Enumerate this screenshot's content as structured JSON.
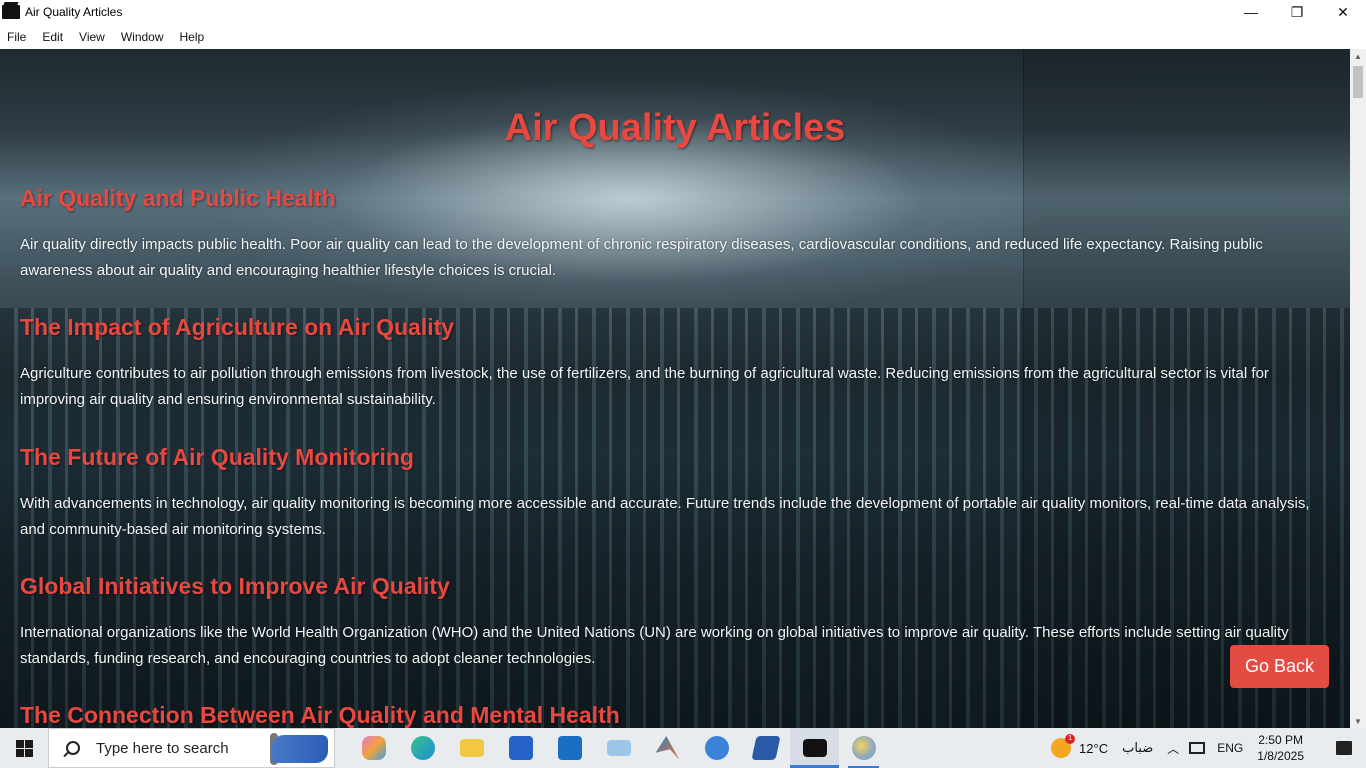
{
  "window": {
    "title": "Air Quality Articles",
    "controls": {
      "minimize": "—",
      "maximize": "❐",
      "close": "✕"
    }
  },
  "menu": [
    "File",
    "Edit",
    "View",
    "Window",
    "Help"
  ],
  "page": {
    "title": "Air Quality Articles",
    "articles": [
      {
        "heading": "Air Quality and Public Health",
        "body": "Air quality directly impacts public health. Poor air quality can lead to the development of chronic respiratory diseases, cardiovascular conditions, and reduced life expectancy. Raising public awareness about air quality and encouraging healthier lifestyle choices is crucial."
      },
      {
        "heading": "The Impact of Agriculture on Air Quality",
        "body": "Agriculture contributes to air pollution through emissions from livestock, the use of fertilizers, and the burning of agricultural waste. Reducing emissions from the agricultural sector is vital for improving air quality and ensuring environmental sustainability."
      },
      {
        "heading": "The Future of Air Quality Monitoring",
        "body": "With advancements in technology, air quality monitoring is becoming more accessible and accurate. Future trends include the development of portable air quality monitors, real-time data analysis, and community-based air monitoring systems."
      },
      {
        "heading": "Global Initiatives to Improve Air Quality",
        "body": "International organizations like the World Health Organization (WHO) and the United Nations (UN) are working on global initiatives to improve air quality. These efforts include setting air quality standards, funding research, and encouraging countries to adopt cleaner technologies."
      },
      {
        "heading": "The Connection Between Air Quality and Mental Health",
        "body": ""
      }
    ],
    "go_back_label": "Go Back"
  },
  "taskbar": {
    "search_placeholder": "Type here to search",
    "apps": [
      {
        "name": "copilot-icon",
        "color": "#c85ad8"
      },
      {
        "name": "edge-icon",
        "color": "#1f8fd6"
      },
      {
        "name": "file-explorer-icon",
        "color": "#f2c744"
      },
      {
        "name": "store-icon",
        "color": "#2563c9"
      },
      {
        "name": "outlook-icon",
        "color": "#1a6fc4"
      },
      {
        "name": "network-app-icon",
        "color": "#5aa0d8"
      },
      {
        "name": "matlab-icon",
        "color": "#e3702c"
      },
      {
        "name": "azure-data-studio-icon",
        "color": "#3b83d6"
      },
      {
        "name": "powershell-icon",
        "color": "#2a5aa8"
      },
      {
        "name": "app-window-icon",
        "color": "#111111"
      },
      {
        "name": "paint-icon",
        "color": "#8aa8c0"
      }
    ],
    "weather": {
      "badge": "1",
      "temp": "12°C",
      "condition": "ضباب"
    },
    "language": "ENG",
    "time": "2:50 PM",
    "date": "1/8/2025"
  }
}
